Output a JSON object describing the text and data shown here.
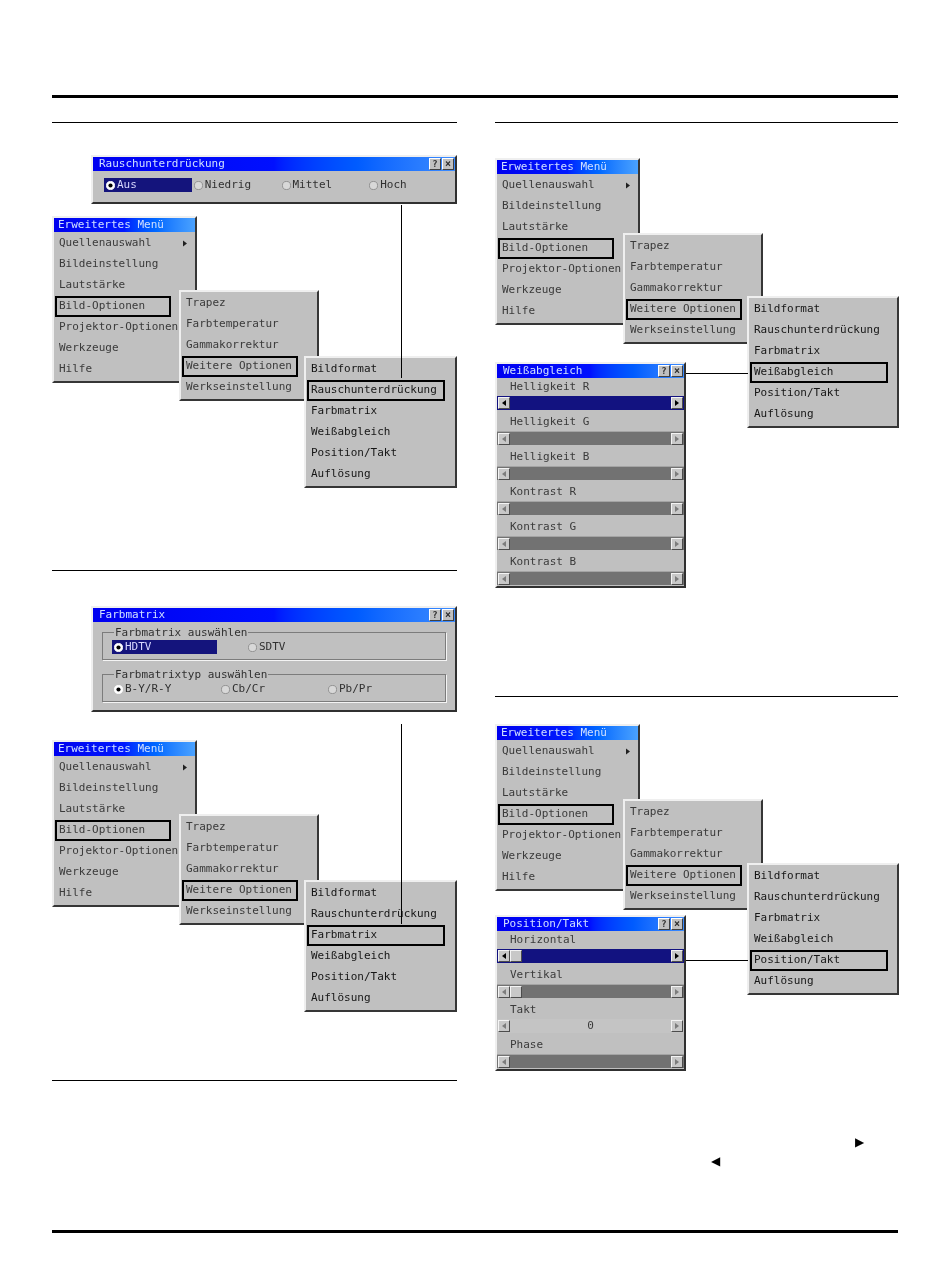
{
  "left_column": {
    "figures": [
      {
        "dialog": {
          "kind": "radio_row",
          "title": "Rauschunterdrückung",
          "help_button": "?",
          "close_button": "×",
          "options": [
            {
              "label": "Aus",
              "selected": true,
              "highlighted": true
            },
            {
              "label": "Niedrig",
              "selected": false,
              "highlighted": false
            },
            {
              "label": "Mittel",
              "selected": false,
              "highlighted": false
            },
            {
              "label": "Hoch",
              "selected": false,
              "highlighted": false
            }
          ]
        },
        "menus": [
          {
            "title": "Erweitertes Menü",
            "items": [
              {
                "label": "Quellenauswahl",
                "submenu_arrow": true,
                "selected": false
              },
              {
                "label": "Bildeinstellung",
                "submenu_arrow": false,
                "selected": false
              },
              {
                "label": "Lautstärke",
                "submenu_arrow": false,
                "selected": false
              },
              {
                "label": "Bild-Optionen",
                "submenu_arrow": false,
                "selected": true
              },
              {
                "label": "Projektor-Optionen",
                "submenu_arrow": false,
                "selected": false
              },
              {
                "label": "Werkzeuge",
                "submenu_arrow": false,
                "selected": false
              },
              {
                "label": "Hilfe",
                "submenu_arrow": false,
                "selected": false
              }
            ]
          },
          {
            "items": [
              {
                "label": "Trapez",
                "selected": false
              },
              {
                "label": "Farbtemperatur",
                "selected": false
              },
              {
                "label": "Gammakorrektur",
                "selected": false
              },
              {
                "label": "Weitere Optionen",
                "selected": true
              },
              {
                "label": "Werkseinstellung",
                "selected": false
              }
            ]
          },
          {
            "items": [
              {
                "label": "Bildformat",
                "selected": false
              },
              {
                "label": "Rauschunterdrückung",
                "selected": true
              },
              {
                "label": "Farbmatrix",
                "selected": false
              },
              {
                "label": "Weißabgleich",
                "selected": false
              },
              {
                "label": "Position/Takt",
                "selected": false
              },
              {
                "label": "Auflösung",
                "selected": false
              }
            ]
          }
        ]
      },
      {
        "dialog": {
          "kind": "radio_groups",
          "title": "Farbmatrix",
          "help_button": "?",
          "close_button": "×",
          "groups": [
            {
              "label": "Farbmatrix auswählen",
              "options": [
                {
                  "label": "HDTV",
                  "selected": true,
                  "highlighted": true
                },
                {
                  "label": "SDTV",
                  "selected": false,
                  "highlighted": false
                }
              ]
            },
            {
              "label": "Farbmatrixtyp auswählen",
              "options": [
                {
                  "label": "B-Y/R-Y",
                  "selected": true,
                  "highlighted": false
                },
                {
                  "label": "Cb/Cr",
                  "selected": false,
                  "highlighted": false
                },
                {
                  "label": "Pb/Pr",
                  "selected": false,
                  "highlighted": false
                }
              ]
            }
          ]
        },
        "menus": [
          {
            "title": "Erweitertes Menü",
            "items": [
              {
                "label": "Quellenauswahl",
                "submenu_arrow": true,
                "selected": false
              },
              {
                "label": "Bildeinstellung",
                "submenu_arrow": false,
                "selected": false
              },
              {
                "label": "Lautstärke",
                "submenu_arrow": false,
                "selected": false
              },
              {
                "label": "Bild-Optionen",
                "submenu_arrow": false,
                "selected": true
              },
              {
                "label": "Projektor-Optionen",
                "submenu_arrow": false,
                "selected": false
              },
              {
                "label": "Werkzeuge",
                "submenu_arrow": false,
                "selected": false
              },
              {
                "label": "Hilfe",
                "submenu_arrow": false,
                "selected": false
              }
            ]
          },
          {
            "items": [
              {
                "label": "Trapez",
                "selected": false
              },
              {
                "label": "Farbtemperatur",
                "selected": false
              },
              {
                "label": "Gammakorrektur",
                "selected": false
              },
              {
                "label": "Weitere Optionen",
                "selected": true
              },
              {
                "label": "Werkseinstellung",
                "selected": false
              }
            ]
          },
          {
            "items": [
              {
                "label": "Bildformat",
                "selected": false
              },
              {
                "label": "Rauschunterdrückung",
                "selected": false
              },
              {
                "label": "Farbmatrix",
                "selected": true
              },
              {
                "label": "Weißabgleich",
                "selected": false
              },
              {
                "label": "Position/Takt",
                "selected": false
              },
              {
                "label": "Auflösung",
                "selected": false
              }
            ]
          }
        ]
      }
    ]
  },
  "right_column": {
    "figures": [
      {
        "menus": [
          {
            "title": "Erweitertes Menü",
            "items": [
              {
                "label": "Quellenauswahl",
                "submenu_arrow": true,
                "selected": false
              },
              {
                "label": "Bildeinstellung",
                "submenu_arrow": false,
                "selected": false
              },
              {
                "label": "Lautstärke",
                "submenu_arrow": false,
                "selected": false
              },
              {
                "label": "Bild-Optionen",
                "submenu_arrow": false,
                "selected": true
              },
              {
                "label": "Projektor-Optionen",
                "submenu_arrow": false,
                "selected": false
              },
              {
                "label": "Werkzeuge",
                "submenu_arrow": false,
                "selected": false
              },
              {
                "label": "Hilfe",
                "submenu_arrow": false,
                "selected": false
              }
            ]
          },
          {
            "items": [
              {
                "label": "Trapez",
                "selected": false
              },
              {
                "label": "Farbtemperatur",
                "selected": false
              },
              {
                "label": "Gammakorrektur",
                "selected": false
              },
              {
                "label": "Weitere Optionen",
                "selected": true
              },
              {
                "label": "Werkseinstellung",
                "selected": false
              }
            ]
          },
          {
            "items": [
              {
                "label": "Bildformat",
                "selected": false
              },
              {
                "label": "Rauschunterdrückung",
                "selected": false
              },
              {
                "label": "Farbmatrix",
                "selected": false
              },
              {
                "label": "Weißabgleich",
                "selected": true
              },
              {
                "label": "Position/Takt",
                "selected": false
              },
              {
                "label": "Auflösung",
                "selected": false
              }
            ]
          }
        ],
        "dialog": {
          "kind": "slider_list",
          "title": "Weißabgleich",
          "help_button": "?",
          "close_button": "×",
          "rows": [
            {
              "label": "Helligkeit R",
              "kind": "slider",
              "thumb": false,
              "selected": true
            },
            {
              "label": "Helligkeit G",
              "kind": "slider",
              "thumb": false,
              "selected": false
            },
            {
              "label": "Helligkeit B",
              "kind": "slider",
              "thumb": false,
              "selected": false
            },
            {
              "label": "Kontrast R",
              "kind": "slider",
              "thumb": false,
              "selected": false
            },
            {
              "label": "Kontrast G",
              "kind": "slider",
              "thumb": false,
              "selected": false
            },
            {
              "label": "Kontrast B",
              "kind": "slider",
              "thumb": false,
              "selected": false
            }
          ]
        }
      },
      {
        "menus": [
          {
            "title": "Erweitertes Menü",
            "items": [
              {
                "label": "Quellenauswahl",
                "submenu_arrow": true,
                "selected": false
              },
              {
                "label": "Bildeinstellung",
                "submenu_arrow": false,
                "selected": false
              },
              {
                "label": "Lautstärke",
                "submenu_arrow": false,
                "selected": false
              },
              {
                "label": "Bild-Optionen",
                "submenu_arrow": false,
                "selected": true
              },
              {
                "label": "Projektor-Optionen",
                "submenu_arrow": false,
                "selected": false
              },
              {
                "label": "Werkzeuge",
                "submenu_arrow": false,
                "selected": false
              },
              {
                "label": "Hilfe",
                "submenu_arrow": false,
                "selected": false
              }
            ]
          },
          {
            "items": [
              {
                "label": "Trapez",
                "selected": false
              },
              {
                "label": "Farbtemperatur",
                "selected": false
              },
              {
                "label": "Gammakorrektur",
                "selected": false
              },
              {
                "label": "Weitere Optionen",
                "selected": true
              },
              {
                "label": "Werkseinstellung",
                "selected": false
              }
            ]
          },
          {
            "items": [
              {
                "label": "Bildformat",
                "selected": false
              },
              {
                "label": "Rauschunterdrückung",
                "selected": false
              },
              {
                "label": "Farbmatrix",
                "selected": false
              },
              {
                "label": "Weißabgleich",
                "selected": false
              },
              {
                "label": "Position/Takt",
                "selected": true
              },
              {
                "label": "Auflösung",
                "selected": false
              }
            ]
          }
        ],
        "dialog": {
          "kind": "slider_list",
          "title": "Position/Takt",
          "help_button": "?",
          "close_button": "×",
          "rows": [
            {
              "label": "Horizontal",
              "kind": "slider",
              "thumb": true,
              "selected": true
            },
            {
              "label": "Vertikal",
              "kind": "slider",
              "thumb": true,
              "selected": false
            },
            {
              "label": "Takt",
              "kind": "value",
              "value": "0",
              "selected": false
            },
            {
              "label": "Phase",
              "kind": "slider",
              "thumb": false,
              "selected": false
            }
          ]
        }
      }
    ],
    "inline_symbols": [
      "▶",
      "◀"
    ]
  }
}
